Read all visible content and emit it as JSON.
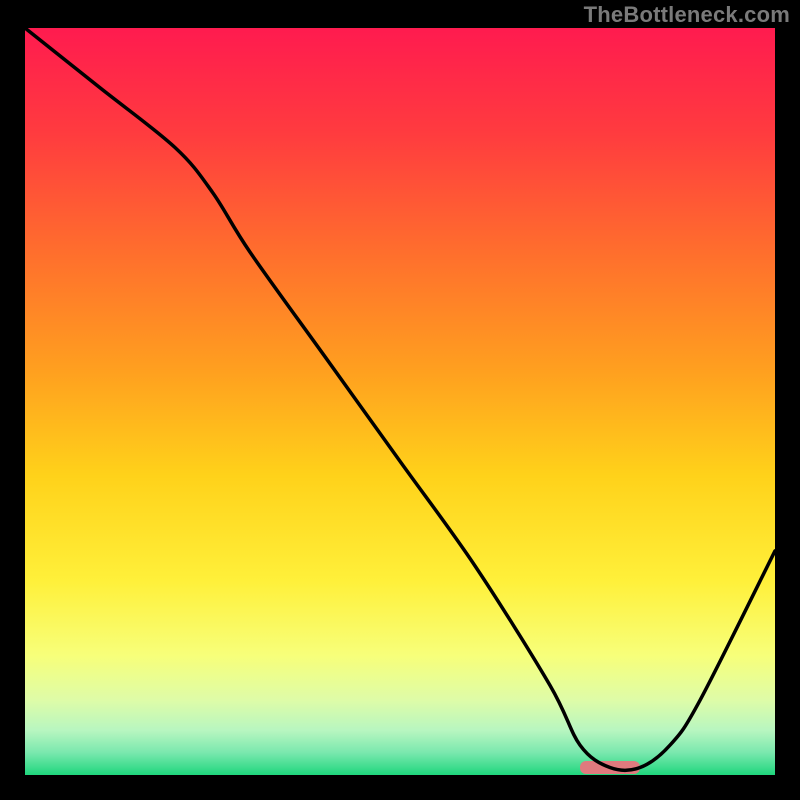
{
  "watermark": "TheBottleneck.com",
  "chart_data": {
    "type": "line",
    "title": "",
    "xlabel": "",
    "ylabel": "",
    "xlim": [
      0,
      100
    ],
    "ylim": [
      0,
      100
    ],
    "grid": false,
    "series": [
      {
        "name": "curve",
        "x": [
          0,
          10,
          20,
          25,
          30,
          40,
          50,
          60,
          70,
          74,
          78,
          82,
          86,
          90,
          100
        ],
        "y": [
          100,
          92,
          84,
          78,
          70,
          56,
          42,
          28,
          12,
          4,
          1,
          1,
          4,
          10,
          30
        ]
      }
    ],
    "plateau_marker": {
      "x_start": 74,
      "x_end": 82,
      "y": 1,
      "color": "#e07a7e"
    },
    "background_gradient": {
      "stops": [
        {
          "offset": 0.0,
          "color": "#ff1b4f"
        },
        {
          "offset": 0.14,
          "color": "#ff3b3f"
        },
        {
          "offset": 0.3,
          "color": "#ff6e2d"
        },
        {
          "offset": 0.46,
          "color": "#ffa01f"
        },
        {
          "offset": 0.6,
          "color": "#ffd21a"
        },
        {
          "offset": 0.74,
          "color": "#fff03a"
        },
        {
          "offset": 0.84,
          "color": "#f7ff7a"
        },
        {
          "offset": 0.9,
          "color": "#defca8"
        },
        {
          "offset": 0.94,
          "color": "#b8f6c0"
        },
        {
          "offset": 0.97,
          "color": "#7ae8ae"
        },
        {
          "offset": 1.0,
          "color": "#1fd67d"
        }
      ]
    }
  }
}
